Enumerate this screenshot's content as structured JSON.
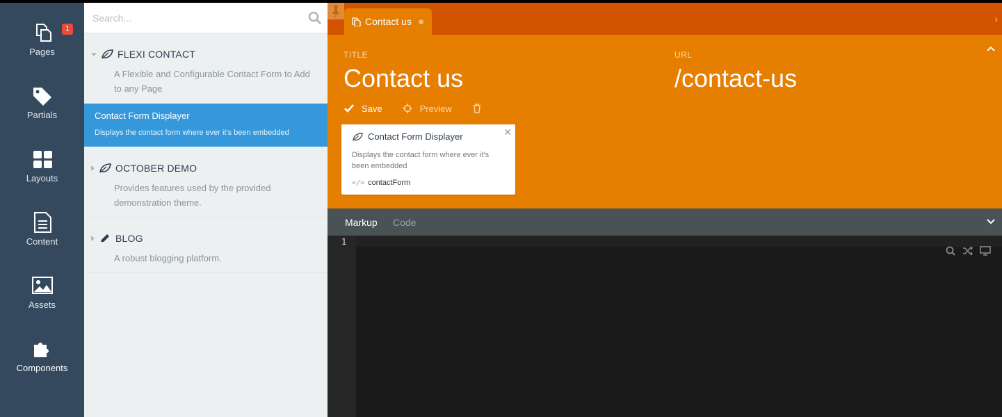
{
  "nav": {
    "items": [
      {
        "label": "Pages",
        "icon": "pages-icon",
        "badge": "1"
      },
      {
        "label": "Partials",
        "icon": "tag-icon"
      },
      {
        "label": "Layouts",
        "icon": "layouts-icon"
      },
      {
        "label": "Content",
        "icon": "document-icon"
      },
      {
        "label": "Assets",
        "icon": "image-icon"
      },
      {
        "label": "Components",
        "icon": "puzzle-icon",
        "active": true
      }
    ]
  },
  "panel": {
    "search_placeholder": "Search...",
    "groups": [
      {
        "title": "FLEXI CONTACT",
        "icon": "leaf-icon",
        "expanded": true,
        "description": "A Flexible and Configurable Contact Form to Add to any Page"
      },
      {
        "title": "OCTOBER DEMO",
        "icon": "leaf-icon",
        "expanded": false,
        "description": "Provides features used by the provided demonstration theme."
      },
      {
        "title": "BLOG",
        "icon": "pencil-icon",
        "expanded": false,
        "description": "A robust blogging platform."
      }
    ],
    "selected_component": {
      "title": "Contact Form Displayer",
      "description": "Displays the contact form where ever it's been embedded"
    }
  },
  "tab": {
    "label": "Contact us"
  },
  "form": {
    "title_label": "TITLE",
    "title_value": "Contact us",
    "url_label": "URL",
    "url_value": "/contact-us"
  },
  "toolbar": {
    "save_label": "Save",
    "preview_label": "Preview"
  },
  "component_card": {
    "title": "Contact Form Displayer",
    "description": "Displays the contact form where ever it's been embedded",
    "alias": "contactForm"
  },
  "editor": {
    "tabs": [
      "Markup",
      "Code"
    ],
    "active_tab": "Markup",
    "line_number": "1"
  },
  "colors": {
    "sidebar": "#34495e",
    "selected": "#3498db",
    "accent": "#e67e00",
    "tabbar": "#d35400",
    "badge": "#e74c3c"
  }
}
